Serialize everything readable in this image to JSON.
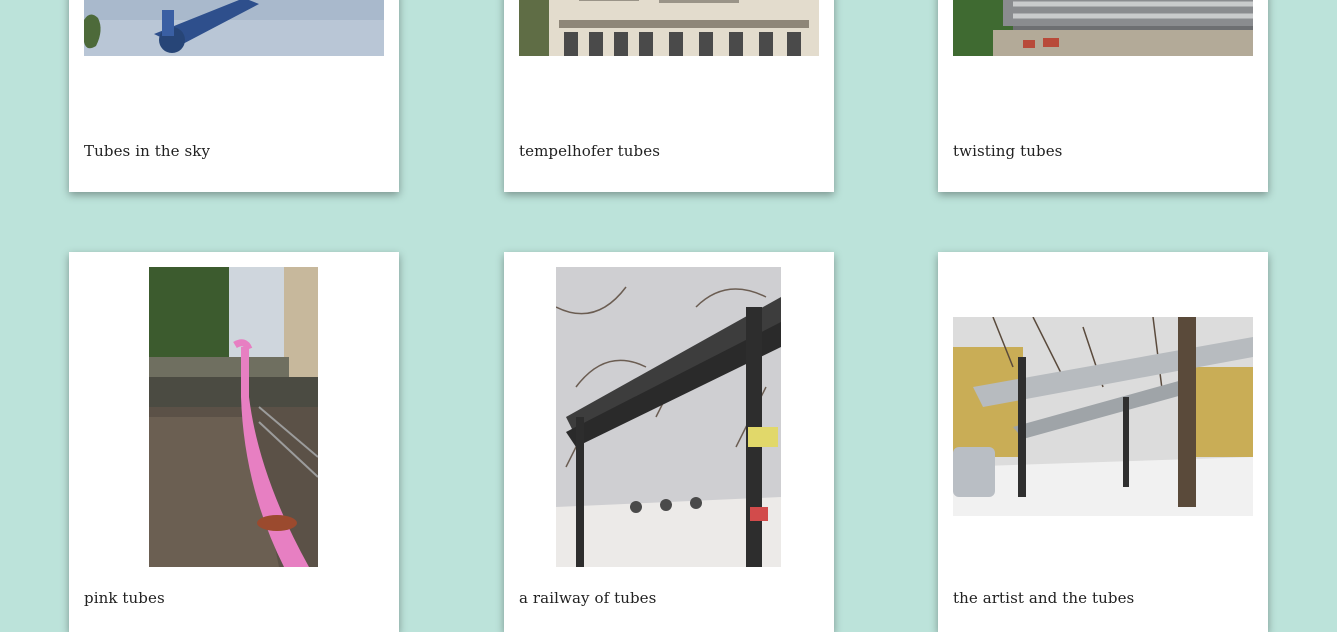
{
  "gallery": {
    "items": [
      {
        "caption": "Tubes in the sky",
        "image": "blue-pipe-sky-photo"
      },
      {
        "caption": "tempelhofer tubes",
        "image": "building-facade-photo"
      },
      {
        "caption": "twisting tubes",
        "image": "fenced-pipes-photo"
      },
      {
        "caption": "pink tubes",
        "image": "pink-pipe-sidewalk-photo"
      },
      {
        "caption": "a railway of tubes",
        "image": "winter-pipe-bridge-photo"
      },
      {
        "caption": "the artist and the tubes",
        "image": "snowy-yard-pipes-photo"
      }
    ]
  },
  "colors": {
    "background": "#bce3da",
    "card": "#ffffff",
    "text": "#222222"
  }
}
